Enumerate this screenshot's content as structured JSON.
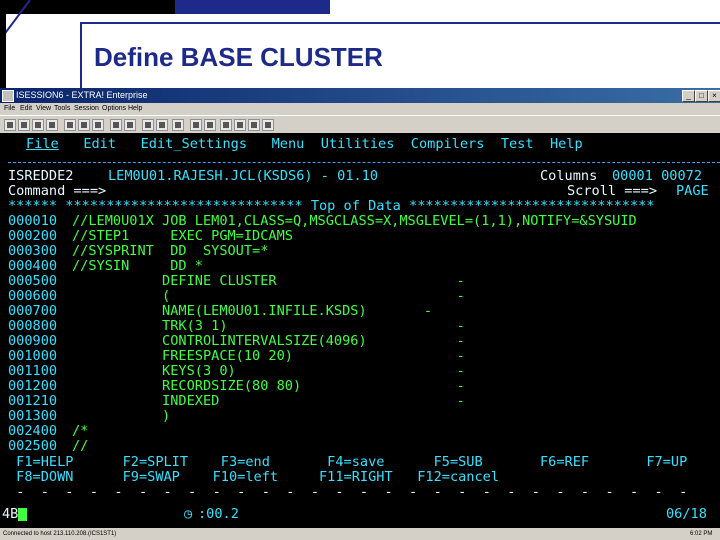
{
  "slide": {
    "title": "Define BASE CLUSTER"
  },
  "window": {
    "title": "ISESSION6 - EXTRA! Enterprise",
    "menu": [
      "File",
      "Edit",
      "View",
      "Tools",
      "Session",
      "Options",
      "Help"
    ]
  },
  "terminal": {
    "menu": [
      "File",
      "Edit",
      "Edit_Settings",
      "Menu",
      "Utilities",
      "Compilers",
      "Test",
      "Help"
    ],
    "panel_id": "ISREDDE2",
    "dataset": "LEM0U01.RAJESH.JCL(KSDS6) - 01.10",
    "columns_label": "Columns",
    "columns_value": "00001 00072",
    "command_label": "Command ===>",
    "scroll_label": "Scroll ===>",
    "scroll_value": "PAGE",
    "top_line": "****** ***************************** Top of Data ******************************",
    "lines": [
      {
        "num": "000010",
        "text": "//LEM0U01X JOB LEM01,CLASS=Q,MSGCLASS=X,MSGLEVEL=(1,1),NOTIFY=&SYSUID"
      },
      {
        "num": "000200",
        "text": "//STEP1     EXEC PGM=IDCAMS"
      },
      {
        "num": "000300",
        "text": "//SYSPRINT  DD  SYSOUT=*"
      },
      {
        "num": "000400",
        "text": "//SYSIN     DD *"
      },
      {
        "num": "000500",
        "text": "           DEFINE CLUSTER                      -"
      },
      {
        "num": "000600",
        "text": "           (                                   -"
      },
      {
        "num": "000700",
        "text": "           NAME(LEM0U01.INFILE.KSDS)       -"
      },
      {
        "num": "000800",
        "text": "           TRK(3 1)                            -"
      },
      {
        "num": "000900",
        "text": "           CONTROLINTERVALSIZE(4096)           -"
      },
      {
        "num": "001000",
        "text": "           FREESPACE(10 20)                    -"
      },
      {
        "num": "001100",
        "text": "           KEYS(3 0)                           -"
      },
      {
        "num": "001200",
        "text": "           RECORDSIZE(80 80)                   -"
      },
      {
        "num": "001210",
        "text": "           INDEXED                             -"
      },
      {
        "num": "001300",
        "text": "           )"
      },
      {
        "num": "002400",
        "text": "/*"
      },
      {
        "num": "002500",
        "text": "//"
      }
    ],
    "fkeys_row1": " F1=HELP      F2=SPLIT    F3=end       F4=save      F5=SUB       F6=REF       F7=UP",
    "fkeys_row2": " F8=DOWN      F9=SWAP    F10=left     F11=RIGHT   F12=cancel",
    "dash_row": " -  -  -  -  -  -  -  -  -  -  -  -  -  -  -  -  -  -  -  -  -  -  -  -  -  -  -  -",
    "session_tag": "4B",
    "timer": ":00.2",
    "cursor_pos": "06/18"
  },
  "statusbar": {
    "left": "Connected to host 213.110.208.(ICS1ST1)",
    "right": "6:02 PM"
  }
}
